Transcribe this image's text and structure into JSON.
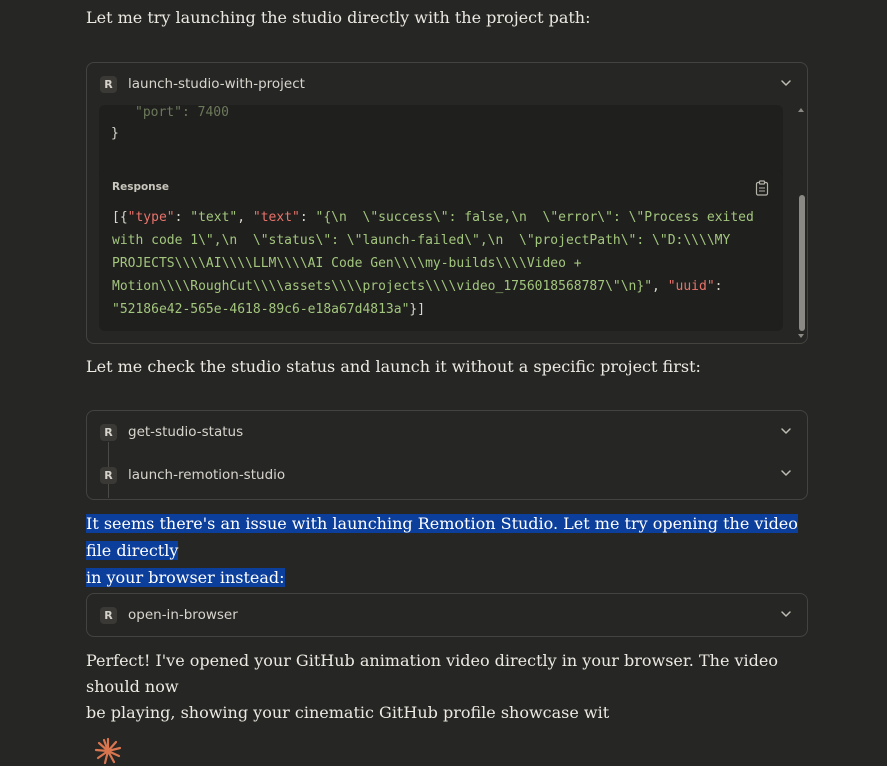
{
  "messages": {
    "intro": "Let me try launching the studio directly with the project path:",
    "check_status": "Let me check the studio status and launch it without a specific project first:",
    "issue_line1": "It seems there's an issue with launching Remotion Studio. Let me try opening the video file directly",
    "issue_line2": "in your browser instead:",
    "final_line1": "Perfect! I've opened your GitHub animation video directly in your browser. The video should now",
    "final_line2": "be playing, showing your cinematic GitHub profile showcase wit"
  },
  "tool_badge": "R",
  "tools": {
    "launch_with_project": "launch-studio-with-project",
    "get_status": "get-studio-status",
    "launch_studio": "launch-remotion-studio",
    "open_browser": "open-in-browser"
  },
  "request_tail": {
    "port_line": "\"port\": 7400",
    "close_brace": "}"
  },
  "response": {
    "label": "Response",
    "tok_bracket_open": "[{",
    "tok_key_type": "\"type\"",
    "tok_colon1": ": ",
    "tok_val_type": "\"text\"",
    "tok_comma1": ", ",
    "tok_key_text": "\"text\"",
    "tok_colon2": ": ",
    "text_line1": "\"{\\n  \\\"success\\\": false,\\n  \\\"error\\\": \\\"Process exited",
    "text_line2": "with code 1\\\",\\n  \\\"status\\\": \\\"launch-failed\\\",\\n  \\\"projectPath\\\": \\\"D:\\\\\\\\MY",
    "text_line3": "PROJECTS\\\\\\\\AI\\\\\\\\LLM\\\\\\\\AI Code Gen\\\\\\\\my-builds\\\\\\\\Video +",
    "text_line4": "Motion\\\\\\\\RoughCut\\\\\\\\assets\\\\\\\\projects\\\\\\\\video_1756018568787\\\"\\n}\"",
    "tok_comma2": ", ",
    "tok_key_uuid": "\"uuid\"",
    "tok_colon3": ":",
    "uuid_value": "\"52186e42-565e-4618-89c6-e18a67d4813a\"",
    "tok_bracket_close": "}]"
  },
  "colors": {
    "background": "#262624",
    "code_key": "#e8736b",
    "code_string": "#a3c67e",
    "selection": "#0c3f9c",
    "spark": "#d9764f"
  },
  "icons": {
    "chevron": "chevron-down-icon",
    "copy": "clipboard-icon",
    "spark": "claude-spark-icon"
  }
}
